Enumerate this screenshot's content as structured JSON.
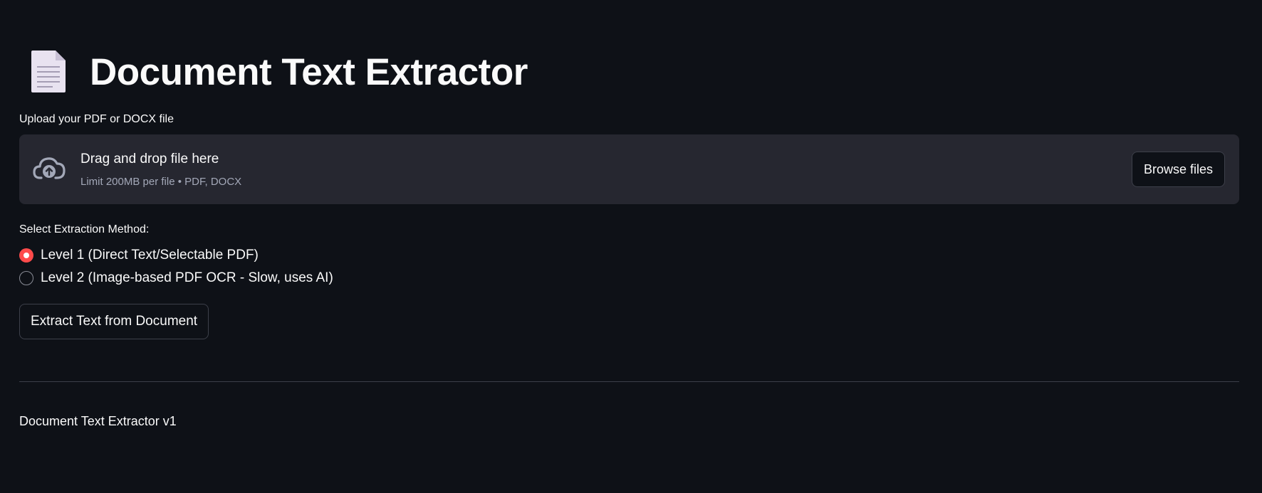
{
  "header": {
    "title": "Document Text Extractor",
    "icon": "document-page-icon"
  },
  "uploader": {
    "label": "Upload your PDF or DOCX file",
    "drop_title": "Drag and drop file here",
    "drop_subtitle": "Limit 200MB per file • PDF, DOCX",
    "browse_label": "Browse files",
    "icon": "cloud-upload-icon"
  },
  "method": {
    "label": "Select Extraction Method:",
    "options": [
      {
        "label": "Level 1 (Direct Text/Selectable PDF)",
        "selected": true
      },
      {
        "label": "Level 2 (Image-based PDF OCR - Slow, uses AI)",
        "selected": false
      }
    ]
  },
  "actions": {
    "extract_label": "Extract Text from Document"
  },
  "footer": {
    "text": "Document Text Extractor v1"
  },
  "colors": {
    "background": "#0e1117",
    "panel": "#262730",
    "accent": "#ff4b4b",
    "text": "#fafafa",
    "muted_text": "#a3a8b8"
  }
}
